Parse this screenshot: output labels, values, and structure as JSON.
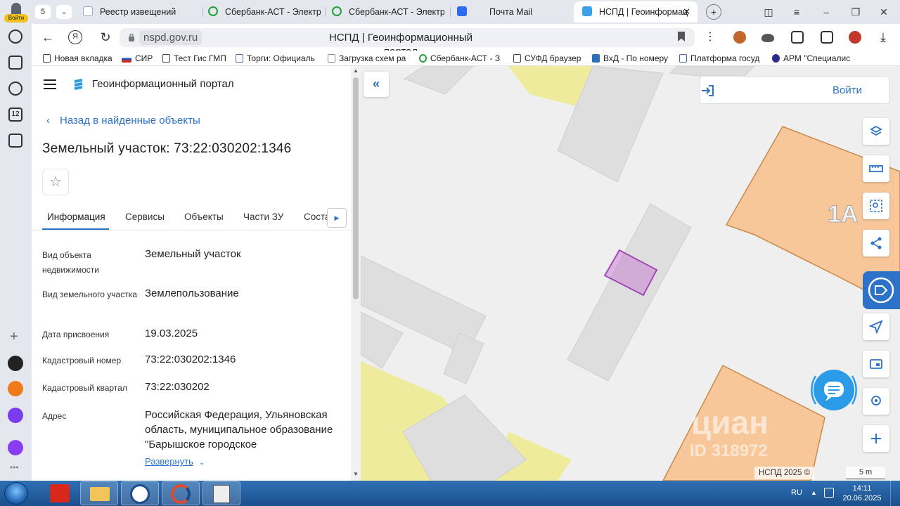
{
  "browser": {
    "profile_label": "Войти",
    "tab_count": "5",
    "tabs": [
      {
        "title": "Реестр извещений"
      },
      {
        "title": "Сбербанк-АСТ - Электр"
      },
      {
        "title": "Сбербанк-АСТ - Электр"
      },
      {
        "title": "Почта Mail"
      },
      {
        "title": "НСПД | Геоинформац"
      }
    ],
    "url_domain": "nspd.gov.ru",
    "page_title": "НСПД | Геоинформационный портал",
    "bookmarks": [
      "Новая вкладка",
      "СИР",
      "Тест Гис ГМП",
      "Торги: Официаль",
      "Загрузка схем ра",
      "Сбербанк-АСТ - З",
      "СУФД браузер",
      "ВхД - По номеру",
      "Платформа госуд",
      "АРМ \"Специалис"
    ],
    "sidebar_badge": "12"
  },
  "panel": {
    "portal_title": "Геоинформационный портал",
    "back_link": "Назад в найденные объекты",
    "object_title": "Земельный участок: 73:22:030202:1346",
    "tabs": [
      "Информация",
      "Сервисы",
      "Объекты",
      "Части ЗУ",
      "Соста"
    ],
    "fields": [
      {
        "label": "Вид объекта недвижимости",
        "value": "Земельный участок"
      },
      {
        "label": "Вид земельного участка",
        "value": "Землепользование"
      },
      {
        "label": "Дата присвоения",
        "value": "19.03.2025"
      },
      {
        "label": "Кадастровый номер",
        "value": "73:22:030202:1346"
      },
      {
        "label": "Кадастровый квартал",
        "value": "73:22:030202"
      },
      {
        "label": "Адрес",
        "value": "Российская Федерация, Ульяновская область, муниципальное образование \"Барышское городское"
      }
    ],
    "expand_link": "Развернуть"
  },
  "map": {
    "login_label": "Войти",
    "building_label": "1А",
    "watermark": "циан",
    "watermark_id": "ID 318972",
    "copyright": "НСПД 2025 ©",
    "scale": "5 m",
    "colors": {
      "parcel_orange": "#f7c79a",
      "parcel_yellow": "#efeb9c",
      "building_grey": "#dedede",
      "selected_parcel": "#a03cb4",
      "accent": "#2b72c8"
    }
  },
  "taskbar": {
    "lang": "RU",
    "time": "14:11",
    "date": "20.06.2025"
  }
}
